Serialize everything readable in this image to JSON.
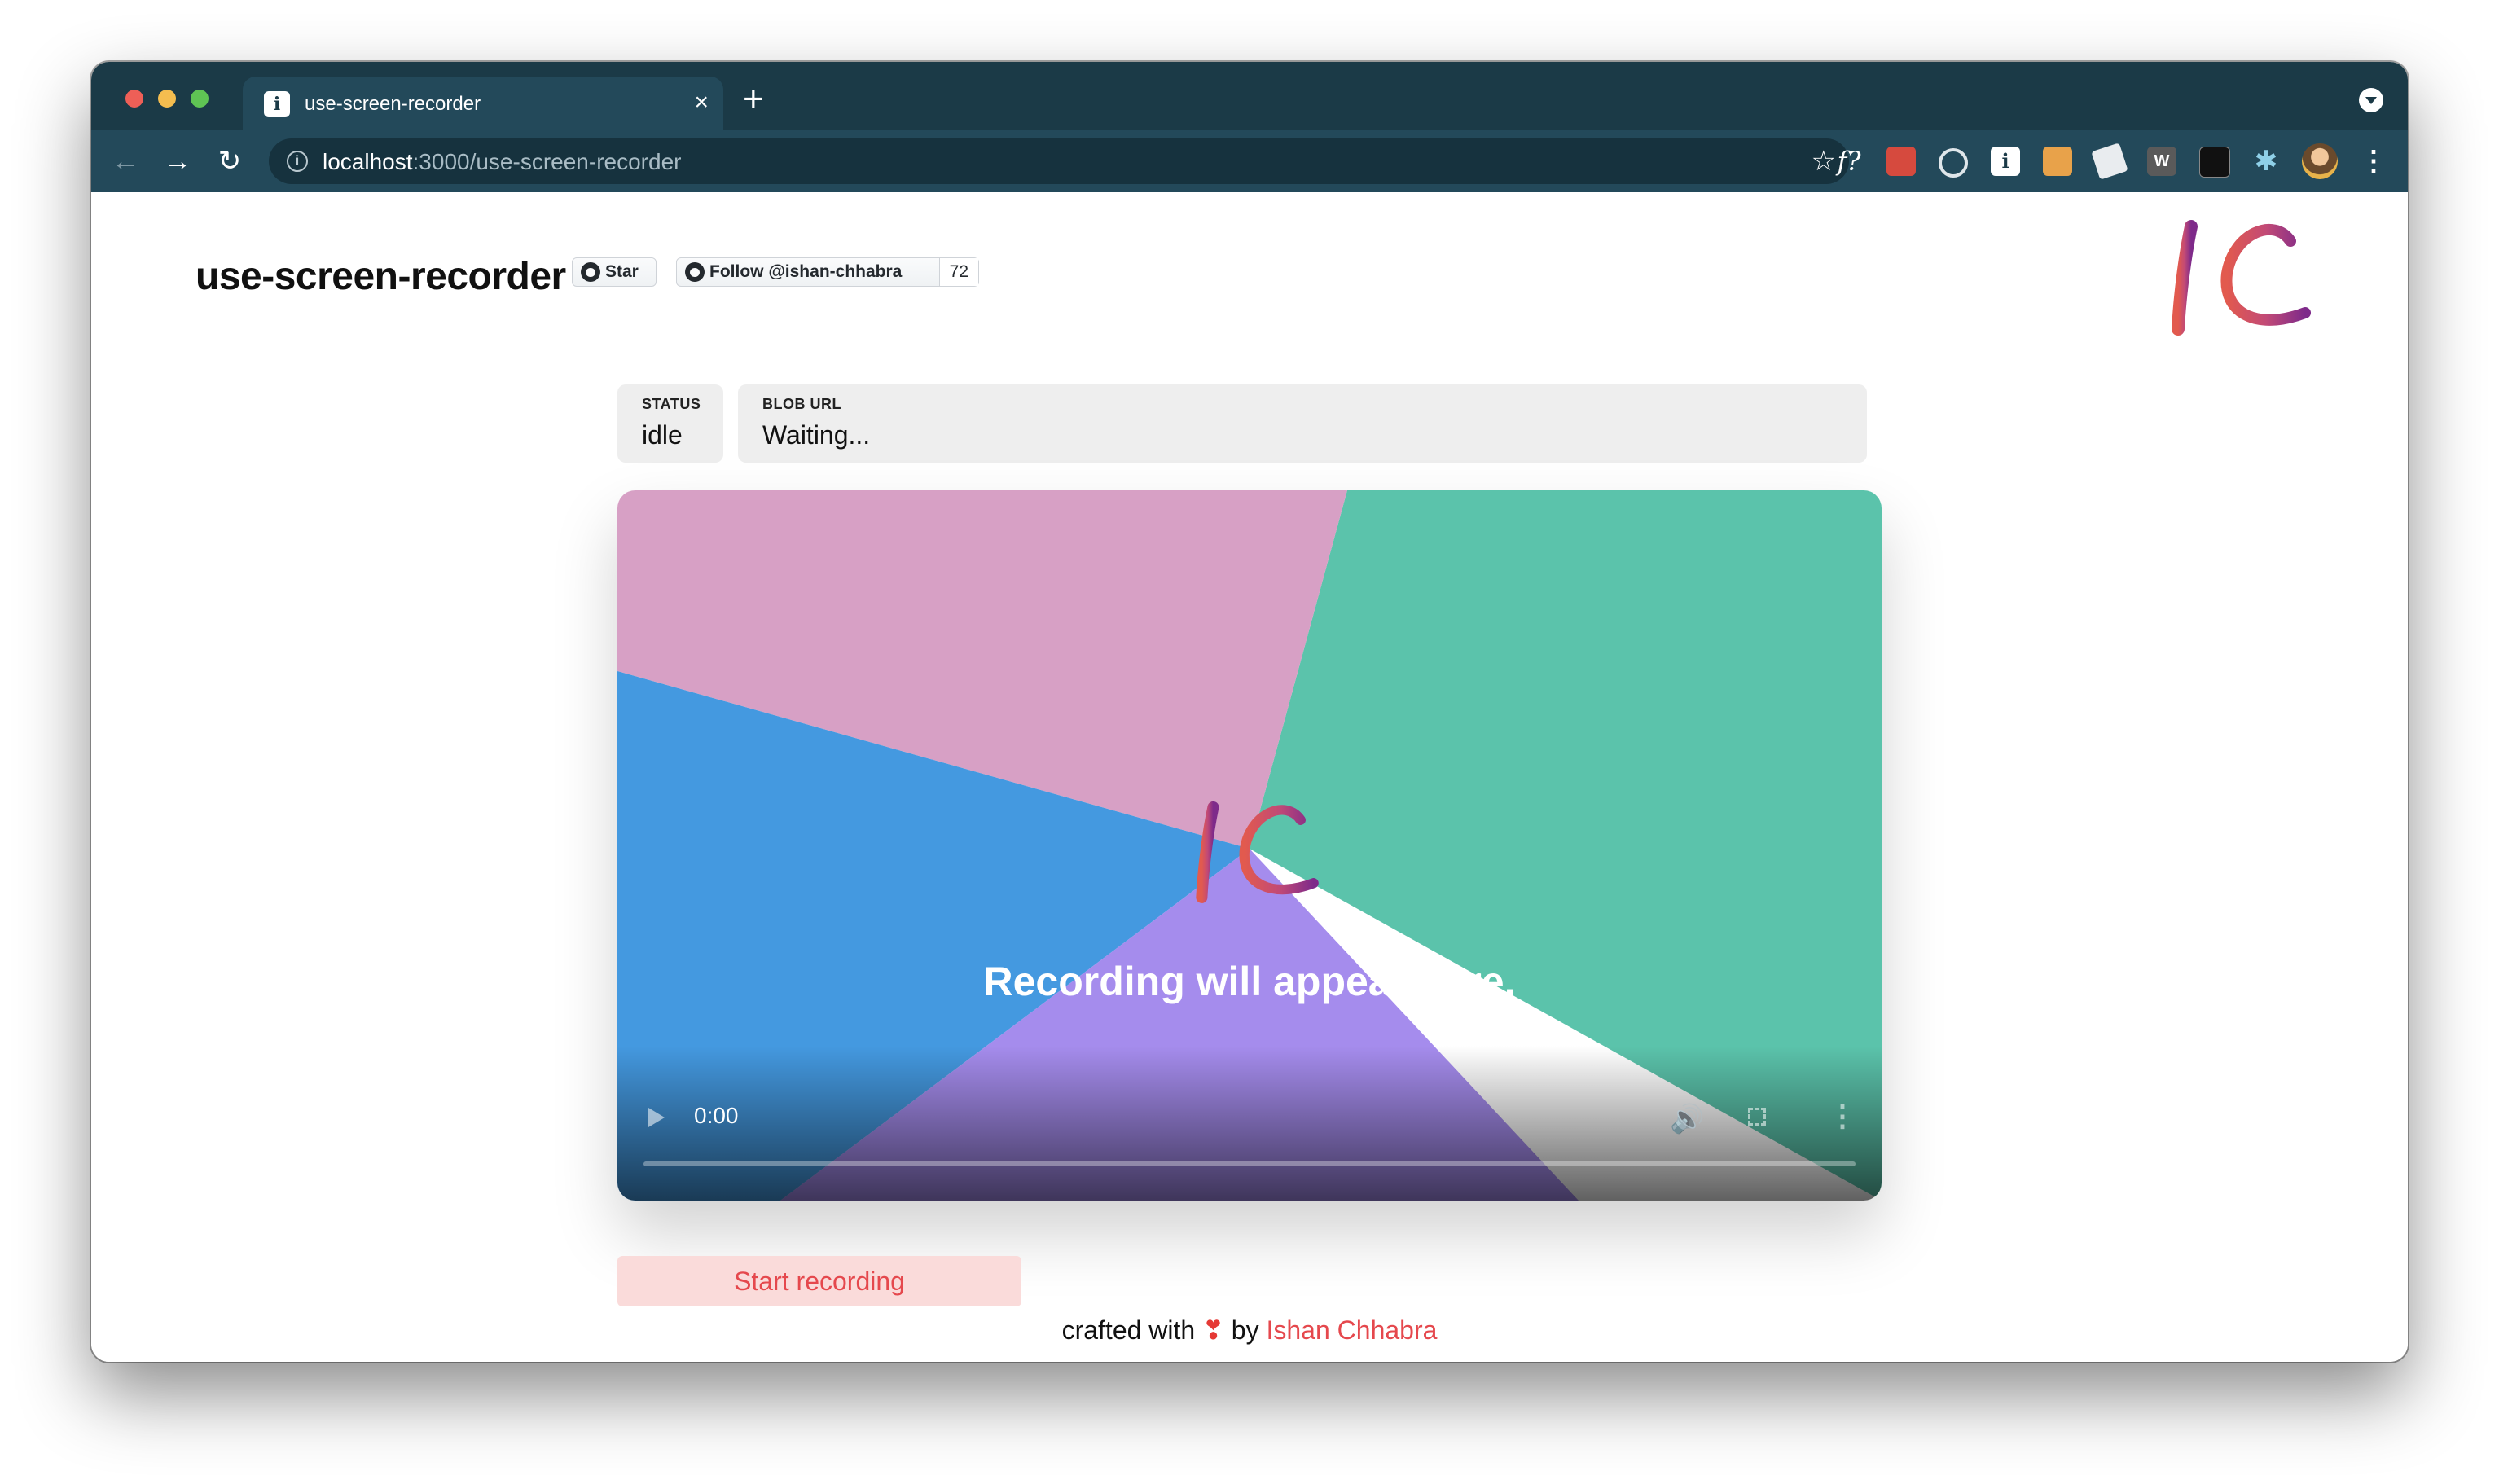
{
  "browser": {
    "tab_title": "use-screen-recorder",
    "tab_close": "×",
    "new_tab": "+",
    "favicon": "i",
    "url_host": "localhost",
    "url_path": ":3000/use-screen-recorder",
    "nav_back": "←",
    "nav_forward": "→",
    "nav_reload": "↻",
    "star": "☆",
    "ext_font": "f?",
    "ext_w": "W",
    "ext_info": "i",
    "menu": "⋮",
    "puzzle": "✱"
  },
  "header": {
    "title": "use-screen-recorder",
    "star_button": "Star",
    "follow_button": "Follow @ishan-chhabra",
    "follow_count": "72"
  },
  "status_card": {
    "label": "STATUS",
    "value": "idle"
  },
  "blob_card": {
    "label": "BLOB URL",
    "value": "Waiting..."
  },
  "video": {
    "caption": "Recording will appear here.",
    "time": "0:00",
    "progress": 0,
    "colors": {
      "pink": "#d7a0c5",
      "green": "#5bc3ab",
      "blue": "#4499e0",
      "purple": "#a58ced"
    }
  },
  "actions": {
    "start_label": "Start recording"
  },
  "footer": {
    "prefix": "crafted with",
    "heart": "❣",
    "by": "by",
    "author": "Ishan Chhabra"
  },
  "icons": [
    "back-arrow-icon",
    "forward-arrow-icon",
    "reload-icon",
    "info-icon",
    "star-icon",
    "github-icon",
    "play-icon",
    "volume-icon",
    "fullscreen-icon",
    "more-vert-icon",
    "puzzle-icon"
  ]
}
